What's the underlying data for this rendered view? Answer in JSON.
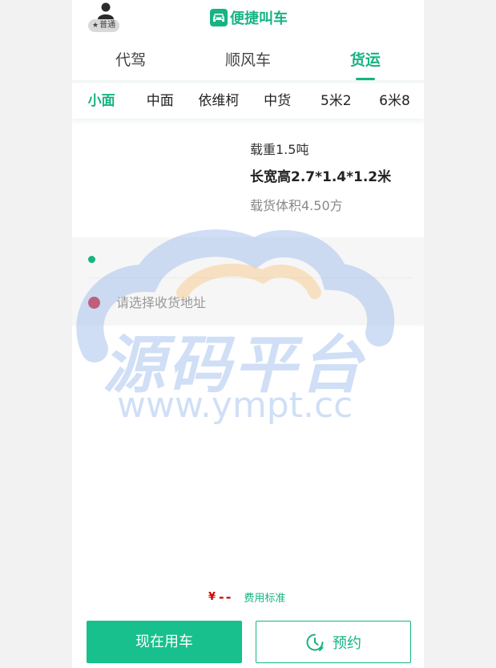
{
  "header": {
    "member_badge": "普通",
    "app_title": "便捷叫车"
  },
  "main_tabs": [
    {
      "label": "代驾",
      "active": false
    },
    {
      "label": "顺风车",
      "active": false
    },
    {
      "label": "货运",
      "active": true
    }
  ],
  "vehicle_tabs": [
    {
      "label": "小面",
      "active": true
    },
    {
      "label": "中面",
      "active": false
    },
    {
      "label": "依维柯",
      "active": false
    },
    {
      "label": "中货",
      "active": false
    },
    {
      "label": "5米2",
      "active": false
    },
    {
      "label": "6米8",
      "active": false
    }
  ],
  "vehicle_spec": {
    "load": "载重1.5吨",
    "dimensions": "长宽高2.7*1.4*1.2米",
    "volume": "载货体积4.50方"
  },
  "address": {
    "start_value": "",
    "end_placeholder": "请选择收货地址"
  },
  "watermark": {
    "text": "源码平台",
    "url": "www.ympt.cc"
  },
  "fee": {
    "currency": "¥",
    "price": "--",
    "standard_link": "费用标准"
  },
  "actions": {
    "now_label": "现在用车",
    "reserve_label": "预约"
  },
  "colors": {
    "accent": "#17b383",
    "button": "#17c08c",
    "price": "#d40000",
    "end_dot": "#e0010b"
  },
  "icons": [
    "user-icon",
    "star-icon",
    "car-icon",
    "clock-icon"
  ]
}
